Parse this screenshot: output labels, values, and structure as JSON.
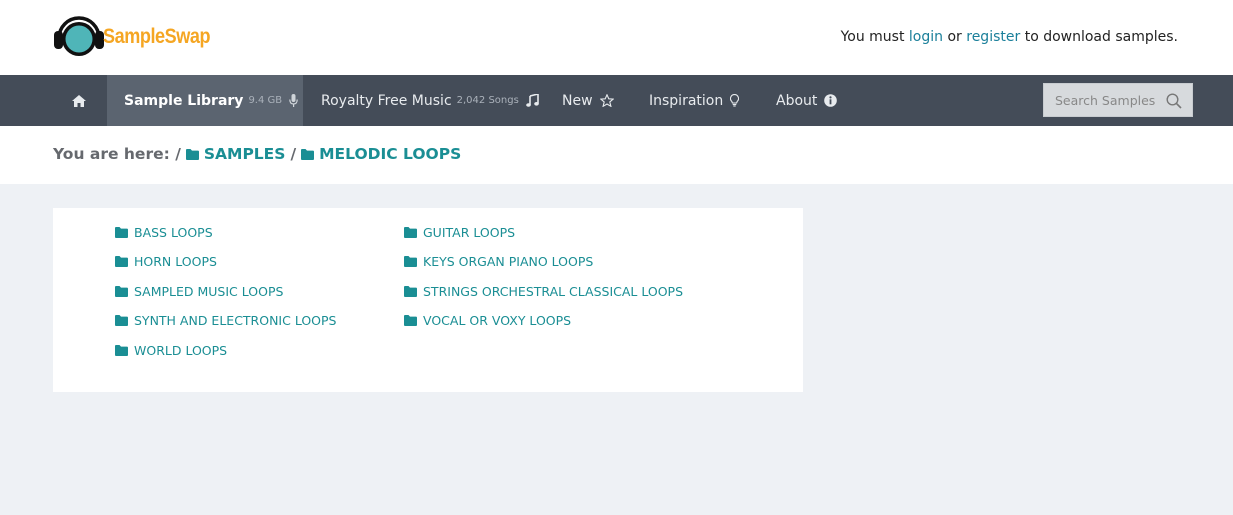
{
  "header": {
    "logo_text": "SampleSwap",
    "auth_prefix": "You must ",
    "login": "login",
    "auth_mid": " or ",
    "register": "register",
    "auth_suffix": " to download samples."
  },
  "nav": {
    "library_label": "Sample Library",
    "library_size": "9.4 GB",
    "royalty_label": "Royalty Free Music",
    "royalty_count": "2,042 Songs",
    "new_label": "New",
    "inspiration_label": "Inspiration",
    "about_label": "About",
    "search_placeholder": "Search Samples"
  },
  "breadcrumb": {
    "prefix": "You are here: /",
    "sep": "/",
    "items": [
      "SAMPLES",
      "MELODIC LOOPS"
    ]
  },
  "folders": [
    "BASS LOOPS",
    "GUITAR LOOPS",
    "HORN LOOPS",
    "KEYS ORGAN PIANO LOOPS",
    "SAMPLED MUSIC LOOPS",
    "STRINGS ORCHESTRAL CLASSICAL LOOPS",
    "SYNTH AND ELECTRONIC LOOPS",
    "VOCAL OR VOXY LOOPS",
    "WORLD LOOPS"
  ],
  "colors": {
    "accent": "#1a8e94",
    "nav_bg": "#444c58",
    "nav_active": "#5b6470",
    "logo": "#f5a623",
    "page_bg": "#eef1f5"
  }
}
